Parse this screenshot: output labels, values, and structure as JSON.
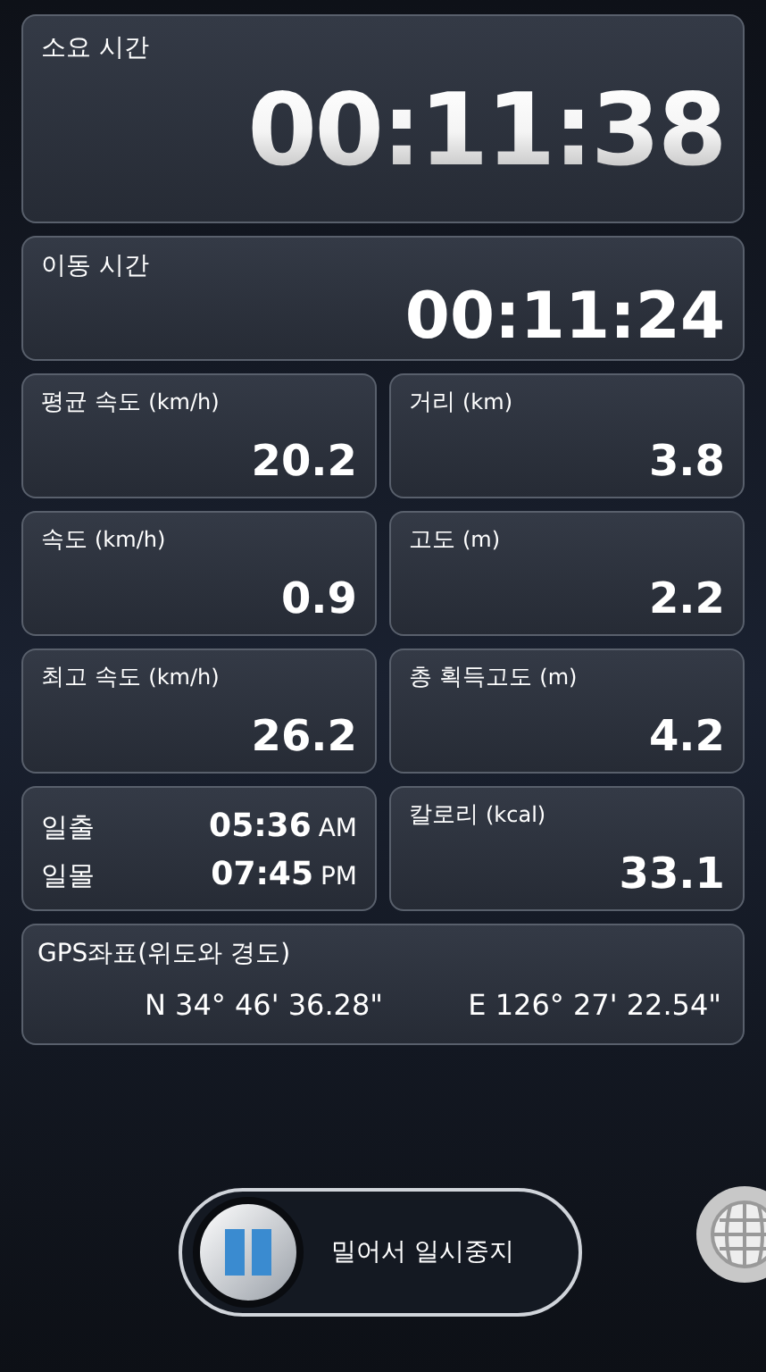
{
  "elapsed": {
    "label": "소요 시간",
    "value": "00:11:38"
  },
  "moving": {
    "label": "이동 시간",
    "value": "00:11:24"
  },
  "cells": [
    {
      "kind": "metric",
      "label": "평균 속도",
      "unit": "(km/h)",
      "value": "20.2"
    },
    {
      "kind": "metric",
      "label": "거리",
      "unit": "(km)",
      "value": "3.8"
    },
    {
      "kind": "metric",
      "label": "속도",
      "unit": "(km/h)",
      "value": "0.9"
    },
    {
      "kind": "metric",
      "label": "고도",
      "unit": "(m)",
      "value": "2.2"
    },
    {
      "kind": "metric",
      "label": "최고 속도",
      "unit": "(km/h)",
      "value": "26.2"
    },
    {
      "kind": "metric",
      "label": "총 획득고도",
      "unit": "(m)",
      "value": "4.2"
    },
    {
      "kind": "sun",
      "rows": [
        {
          "label": "일출",
          "time": "05:36",
          "suffix": "AM"
        },
        {
          "label": "일몰",
          "time": "07:45",
          "suffix": "PM"
        }
      ]
    },
    {
      "kind": "metric",
      "label": "칼로리",
      "unit": "(kcal)",
      "value": "33.1"
    }
  ],
  "gps": {
    "label": "GPS좌표(위도와 경도)",
    "latitude": "N 34° 46' 36.28\"",
    "longitude": "E 126° 27' 22.54\""
  },
  "slider": {
    "label": "밀어서 일시중지",
    "level": 0
  }
}
